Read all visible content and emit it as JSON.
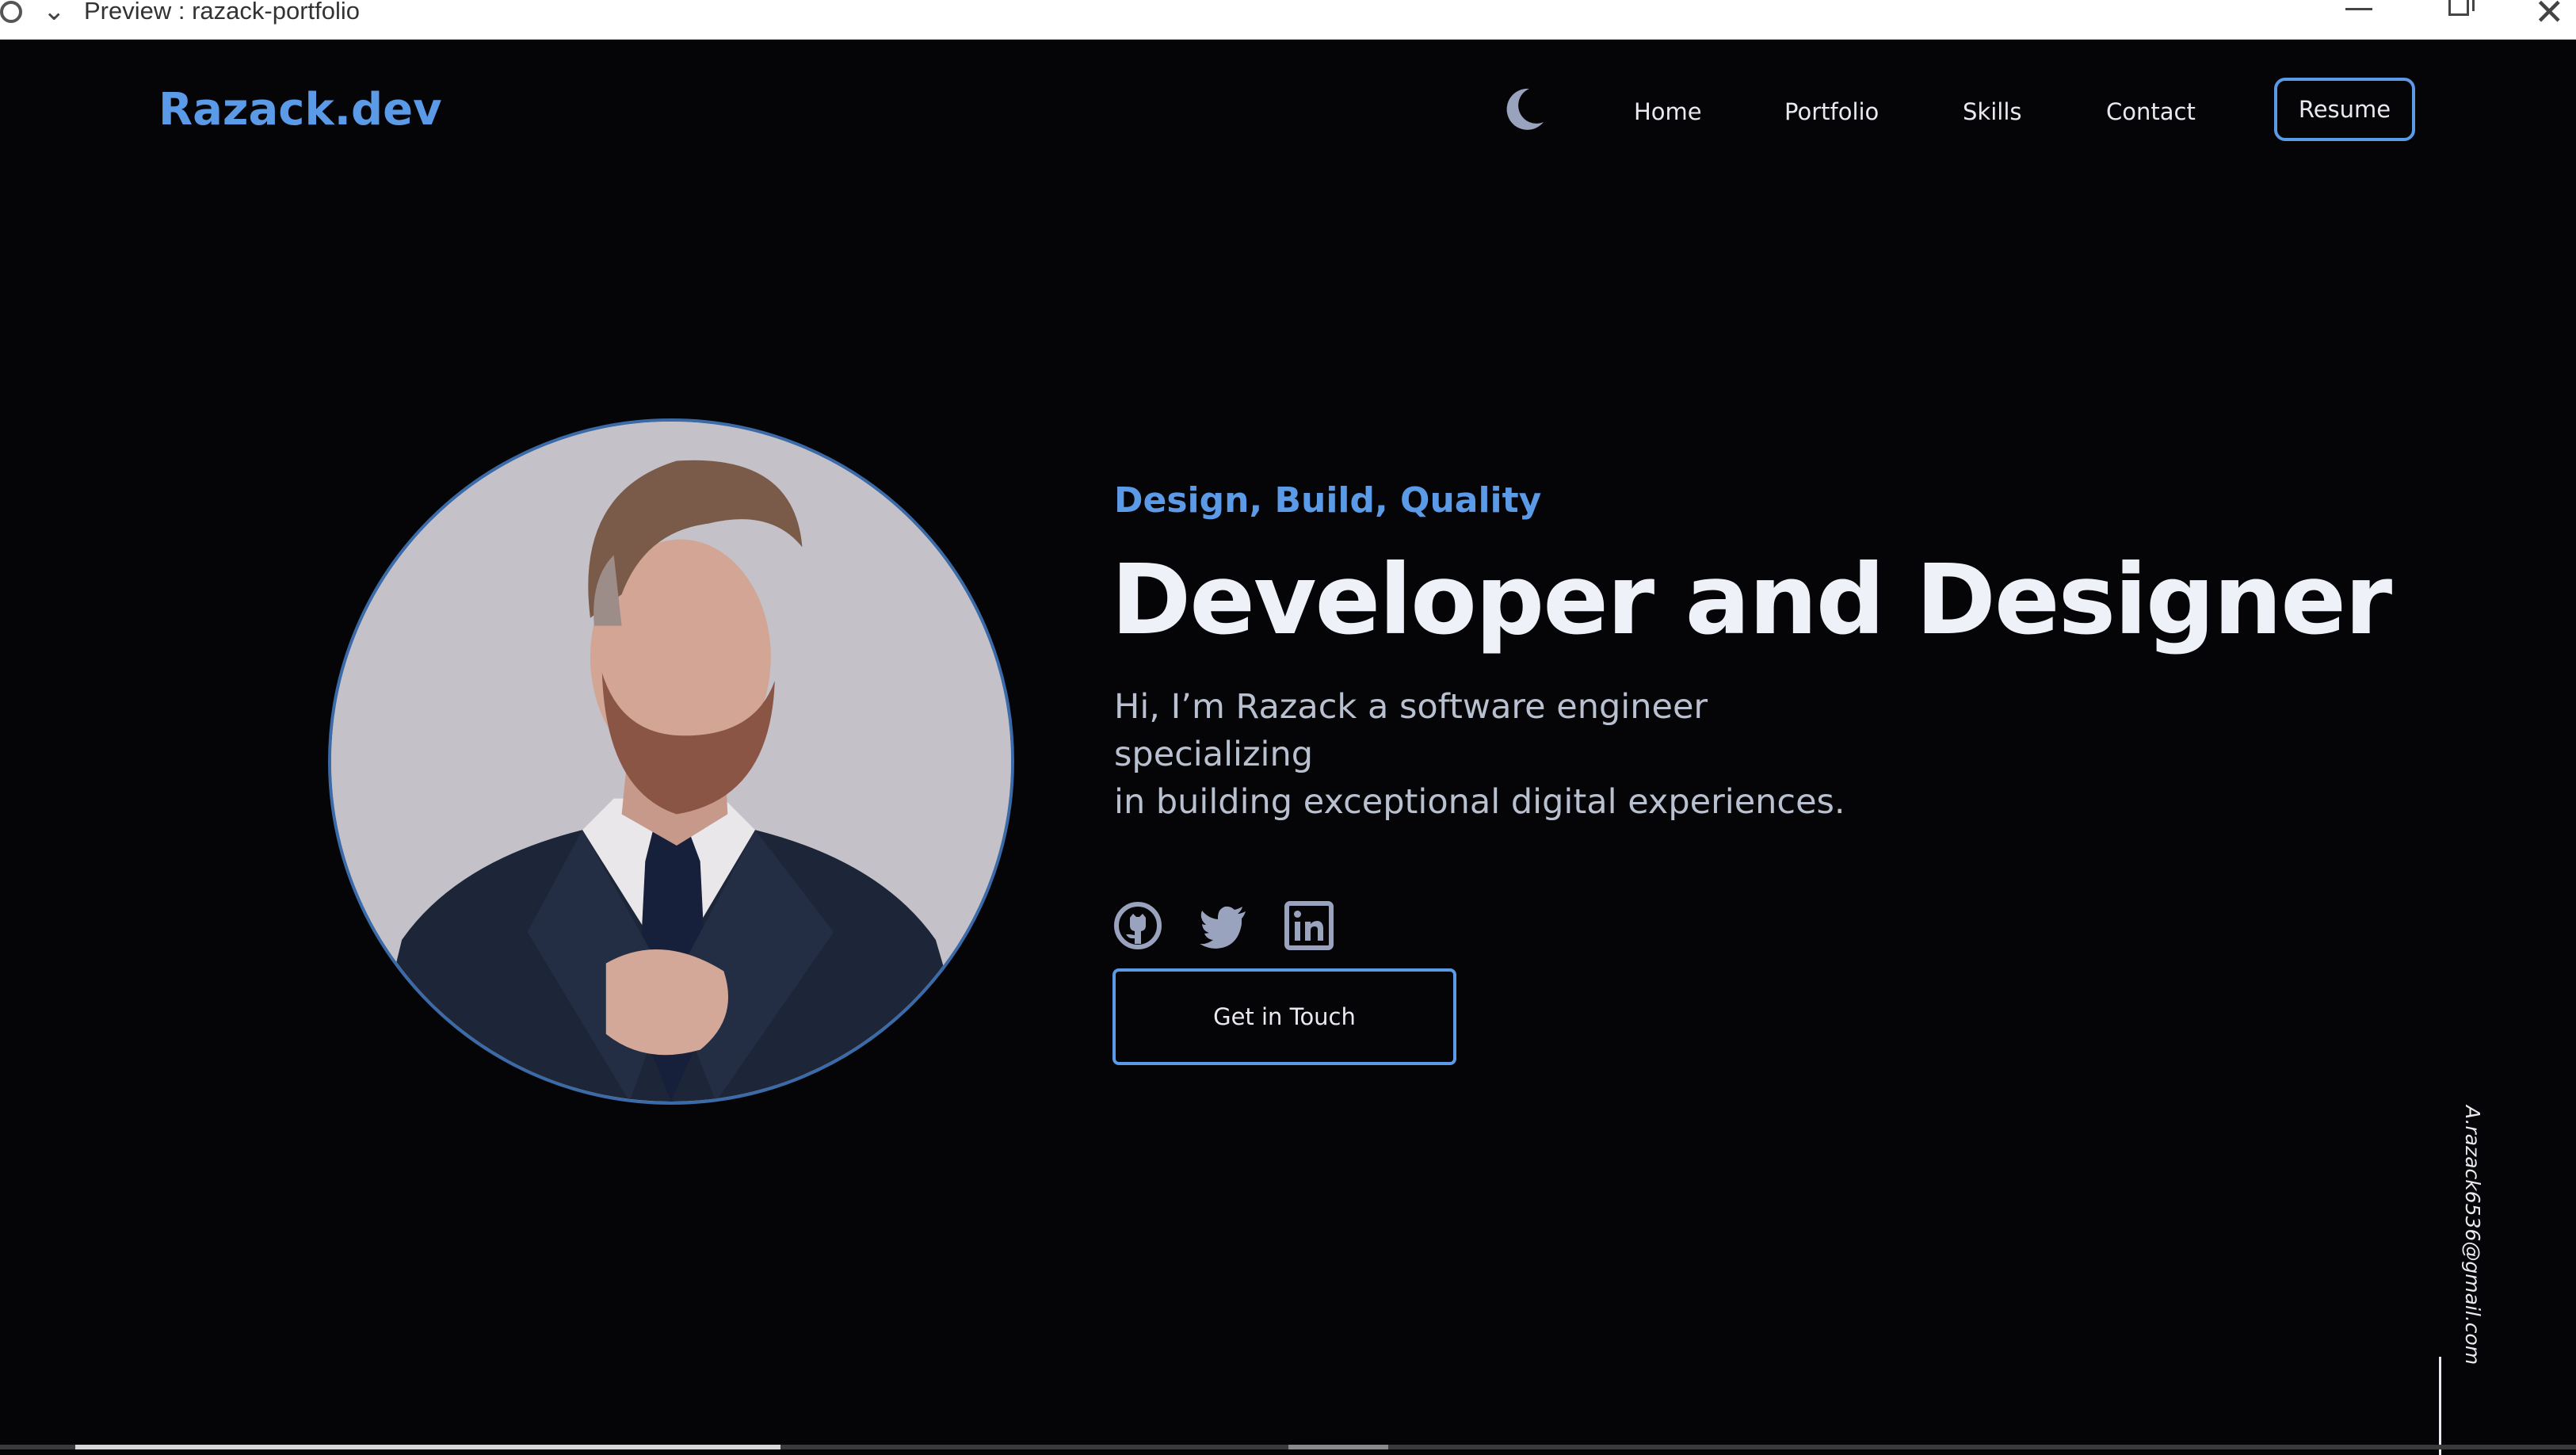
{
  "window": {
    "title": "Preview : razack-portfolio"
  },
  "header": {
    "logo": "Razack.dev",
    "theme_toggle_icon": "moon-icon",
    "nav": [
      {
        "label": "Home"
      },
      {
        "label": "Portfolio"
      },
      {
        "label": "Skills"
      },
      {
        "label": "Contact"
      }
    ],
    "resume_label": "Resume"
  },
  "hero": {
    "tagline": "Design, Build, Quality",
    "headline": "Developer and Designer",
    "intro_line1": "Hi, I’m Razack a software engineer specializing",
    "intro_line2": "in building exceptional digital experiences.",
    "social": [
      {
        "icon": "github-icon"
      },
      {
        "icon": "twitter-icon"
      },
      {
        "icon": "linkedin-icon"
      }
    ],
    "cta_label": "Get in Touch"
  },
  "side": {
    "email": "A.razack6536@gmail.com"
  },
  "colors": {
    "background": "#050507",
    "accent": "#5a9ae6",
    "text": "#eef1f8",
    "muted_text": "#b9c0cf"
  }
}
